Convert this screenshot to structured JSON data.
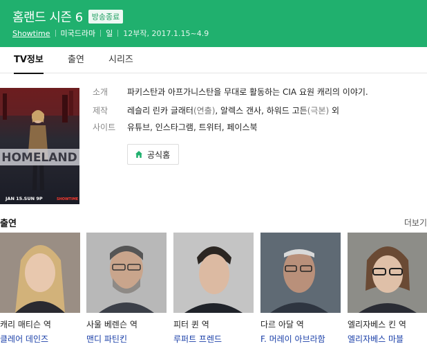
{
  "show": {
    "title": "홈랜드 시즌 6",
    "badge": "방송종료",
    "meta": {
      "network": "Showtime",
      "genre": "미국드라마",
      "day": "일",
      "info": "12부작, 2017.1.15~4.9"
    }
  },
  "tabs": [
    {
      "label": "TV정보"
    },
    {
      "label": "출연"
    },
    {
      "label": "시리즈"
    }
  ],
  "poster": {
    "logo_text": "HOMELAND",
    "air_text": "JAN 15.SUN 9P",
    "network_text": "SHOWTIME"
  },
  "info": {
    "synopsis": {
      "key": "소개",
      "value": "파키스탄과 아프가니스탄을 무대로 활동하는 CIA 요원 캐리의 이야기."
    },
    "production": {
      "key": "제작",
      "p1": "레슬리 린카 글래터",
      "p1_role": "(연출)",
      "sep1": ", ",
      "p2": "알렉스 갠사",
      "sep2": ", ",
      "p3": "하워드 고든",
      "p3_role": "(극본)",
      "suffix": " 외"
    },
    "sites": {
      "key": "사이트",
      "s1": "유튜브",
      "sep1": ", ",
      "s2": "인스타그램",
      "sep2": ", ",
      "s3": "트위터",
      "sep3": ", ",
      "s4": "페이스북"
    }
  },
  "home_button": {
    "label": "공식홈",
    "icon": "home-icon"
  },
  "cast": {
    "title": "출연",
    "more": "더보기",
    "members": [
      {
        "role": "캐리 매티슨 역",
        "name": "클레어 데인즈"
      },
      {
        "role": "사울 베렌슨 역",
        "name": "맨디 파틴킨"
      },
      {
        "role": "피터 퀸 역",
        "name": "루퍼트 프렌드"
      },
      {
        "role": "다르 아달 역",
        "name": "F. 머레이 아브라함"
      },
      {
        "role": "엘리자베스 킨 역",
        "name": "엘리자베스 마블"
      }
    ]
  },
  "colors": {
    "header_bg": "#20b06e",
    "cast_name": "#1a3fa8"
  }
}
